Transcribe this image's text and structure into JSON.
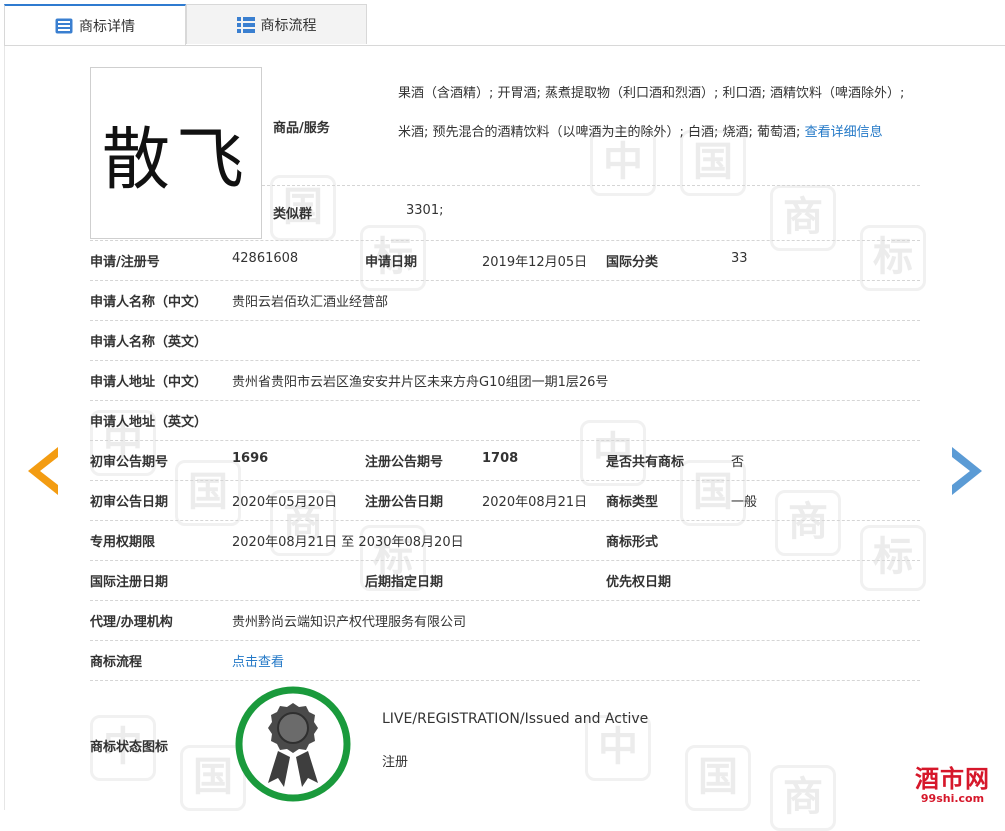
{
  "tabs": [
    {
      "label": "商标详情",
      "icon": "document-list-icon",
      "active": true
    },
    {
      "label": "商标流程",
      "icon": "grid-list-icon",
      "active": false
    }
  ],
  "trademark": {
    "name": "散飞"
  },
  "goods": {
    "label": "商品/服务",
    "text": "果酒（含酒精）; 开胃酒; 蒸煮提取物（利口酒和烈酒）; 利口酒; 酒精饮料（啤酒除外）; 米酒; 预先混合的酒精饮料（以啤酒为主的除外）; 白酒; 烧酒; 葡萄酒;",
    "more_link": "查看详细信息"
  },
  "similar_group": {
    "label": "类似群",
    "value": "3301;"
  },
  "rows": {
    "reg_no": {
      "label": "申请/注册号",
      "value": "42861608"
    },
    "apply_date": {
      "label": "申请日期",
      "value": "2019年12月05日"
    },
    "intl_class": {
      "label": "国际分类",
      "value": "33"
    },
    "applicant_cn": {
      "label": "申请人名称（中文）",
      "value": "贵阳云岩佰玖汇酒业经营部"
    },
    "applicant_en": {
      "label": "申请人名称（英文）",
      "value": ""
    },
    "address_cn": {
      "label": "申请人地址（中文）",
      "value": "贵州省贵阳市云岩区渔安安井片区未来方舟G10组团一期1层26号"
    },
    "address_en": {
      "label": "申请人地址（英文）",
      "value": ""
    },
    "prelim_issue": {
      "label": "初审公告期号",
      "value": "1696"
    },
    "reg_issue": {
      "label": "注册公告期号",
      "value": "1708"
    },
    "shared": {
      "label": "是否共有商标",
      "value": "否"
    },
    "prelim_date": {
      "label": "初审公告日期",
      "value": "2020年05月20日"
    },
    "reg_date": {
      "label": "注册公告日期",
      "value": "2020年08月21日"
    },
    "tm_type": {
      "label": "商标类型",
      "value": "一般"
    },
    "exclusive": {
      "label": "专用权期限",
      "value": "2020年08月21日 至 2030年08月20日"
    },
    "tm_form": {
      "label": "商标形式",
      "value": ""
    },
    "intl_reg_date": {
      "label": "国际注册日期",
      "value": ""
    },
    "later_date": {
      "label": "后期指定日期",
      "value": ""
    },
    "priority_date": {
      "label": "优先权日期",
      "value": ""
    },
    "agent": {
      "label": "代理/办理机构",
      "value": "贵州黔尚云端知识产权代理服务有限公司"
    },
    "flow": {
      "label": "商标流程",
      "link": "点击查看"
    }
  },
  "status": {
    "label": "商标状态图标",
    "english": "LIVE/REGISTRATION/Issued and Active",
    "chinese": "注册",
    "badge_color": "#1a9a3c",
    "icon": "award-ribbon-icon"
  },
  "nav": {
    "prev_color": "#f39c12",
    "next_color": "#5b9bd5"
  },
  "watermark": [
    "中",
    "国",
    "商",
    "标"
  ],
  "site_logo": {
    "name": "酒市网",
    "domain": "99shi.com"
  }
}
